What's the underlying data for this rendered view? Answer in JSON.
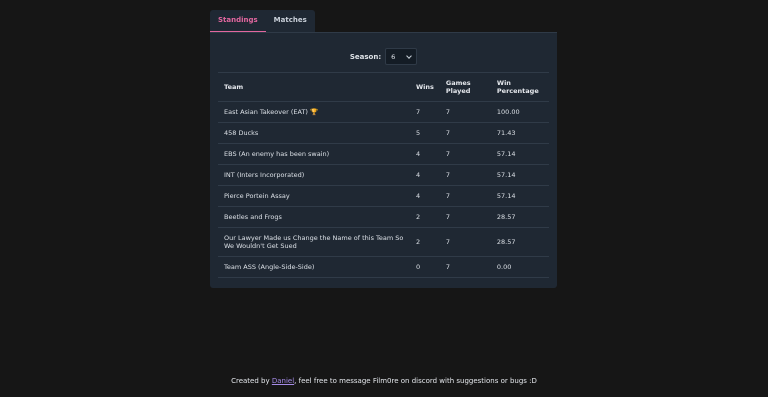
{
  "tabs": [
    {
      "label": "Standings",
      "active": true
    },
    {
      "label": "Matches",
      "active": false
    }
  ],
  "season": {
    "label": "Season:",
    "value": "6"
  },
  "table": {
    "headers": {
      "team": "Team",
      "wins": "Wins",
      "games_played": "Games Played",
      "win_percentage": "Win Percentage"
    },
    "rows": [
      {
        "team": "East Asian Takeover (EAT)",
        "trophy": "🏆",
        "wins": "7",
        "games_played": "7",
        "win_percentage": "100.00"
      },
      {
        "team": "458 Ducks",
        "wins": "5",
        "games_played": "7",
        "win_percentage": "71.43"
      },
      {
        "team": "EBS (An enemy has been swain)",
        "wins": "4",
        "games_played": "7",
        "win_percentage": "57.14"
      },
      {
        "team": "INT (Inters Incorporated)",
        "wins": "4",
        "games_played": "7",
        "win_percentage": "57.14"
      },
      {
        "team": "Pierce Portein Assay",
        "wins": "4",
        "games_played": "7",
        "win_percentage": "57.14"
      },
      {
        "team": "Beetles and Frogs",
        "wins": "2",
        "games_played": "7",
        "win_percentage": "28.57"
      },
      {
        "team": "Our Lawyer Made us Change the Name of this Team So We Wouldn't Get Sued",
        "wins": "2",
        "games_played": "7",
        "win_percentage": "28.57"
      },
      {
        "team": "Team ASS (Angle-Side-Side)",
        "wins": "0",
        "games_played": "7",
        "win_percentage": "0.00"
      }
    ]
  },
  "footer": {
    "prefix": "Created by ",
    "author": "Daniel",
    "suffix": ", feel free to message Film0re on discord with suggestions or bugs :D"
  },
  "colors": {
    "accent": "#e2679f",
    "link": "#a58be6",
    "background": "#161616",
    "panel": "#1f2833"
  }
}
